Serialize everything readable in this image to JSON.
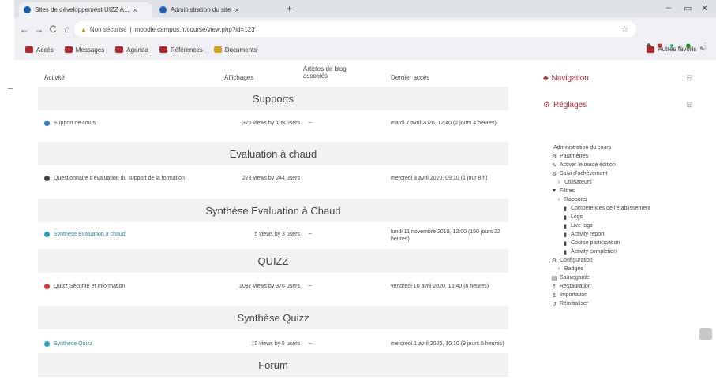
{
  "browser": {
    "tabs": [
      {
        "title": "Sites de développement UIZZ A...",
        "active": true
      },
      {
        "title": "Administration du site",
        "active": false
      }
    ],
    "new_tab": "+",
    "window_controls": {
      "minimize": "–",
      "restore": "▭",
      "close": "✕"
    },
    "nav": {
      "back": "←",
      "forward": "→",
      "reload": "C",
      "home": "⌂"
    },
    "address": {
      "security_label": "Non sécurisé",
      "url": "moodle.campus.fr/course/view.php?id=123"
    },
    "bookmarks": [
      {
        "label": "Accès",
        "color": "#b3262e"
      },
      {
        "label": "Messages",
        "color": "#b3262e"
      },
      {
        "label": "Agenda",
        "color": "#b3262e"
      },
      {
        "label": "Références",
        "color": "#b3262e"
      },
      {
        "label": "Documents",
        "color": "#d8a11c"
      }
    ],
    "bookmarks_right": "Autres favoris"
  },
  "table": {
    "headers": {
      "activity": "Activité",
      "views": "Affichages",
      "blog": "Articles de blog associés",
      "last_access": "Dernier accès"
    },
    "sections": [
      {
        "title": "Supports",
        "rows": [
          {
            "icon_color": "#2a7fbf",
            "activity": "Support de cours",
            "link": false,
            "views": "375 views by 109 users",
            "blog": "–",
            "last_access": "mardi 7 avril 2020, 12:40 (2 jours 4 heures)"
          }
        ]
      },
      {
        "title": "Evaluation à chaud",
        "rows": [
          {
            "icon_color": "#444444",
            "activity": "Questionnaire d'évaluation du support de la formation",
            "link": false,
            "views": "273 views by 244 users",
            "blog": "",
            "last_access": "mercredi 8 avril 2020, 09:10 (1 jour 8 h)"
          }
        ]
      },
      {
        "title": "Synthèse Evaluation à Chaud",
        "rows": [
          {
            "icon_color": "#2aa3b8",
            "activity": "Synthèse Evaluation à chaud",
            "link": true,
            "views": "5 views by 3 users",
            "blog": "–",
            "last_access": "lundi 11 novembre 2019, 12:00 (150 jours 22 heures)"
          }
        ]
      },
      {
        "title": "QUIZZ",
        "rows": [
          {
            "icon_color": "#d33a3a",
            "activity": "Quizz Sécurité et Information",
            "link": false,
            "views": "2087 views by 376 users",
            "blog": "–",
            "last_access": "vendredi 10 avril 2020, 15:40 (6 heures)"
          }
        ]
      },
      {
        "title": "Synthèse Quizz",
        "rows": [
          {
            "icon_color": "#2aa3b8",
            "activity": "Synthèse Quizz",
            "link": true,
            "views": "10 views by 5 users",
            "blog": "–",
            "last_access": "mercredi 1 avril 2020, 10:10 (9 jours 5 heures)"
          }
        ]
      },
      {
        "title": "Forum",
        "rows": []
      }
    ]
  },
  "sidebar": {
    "navigation_title": "Navigation",
    "settings_title": "Réglages",
    "collapse_symbol": "⊟",
    "tree": [
      {
        "level": 1,
        "icon": "",
        "label": "Administration du cours"
      },
      {
        "level": 2,
        "icon": "⚙",
        "label": "Paramètres"
      },
      {
        "level": 2,
        "icon": "✎",
        "label": "Activer le mode édition"
      },
      {
        "level": 2,
        "icon": "⚙",
        "label": "Suivi d'achèvement"
      },
      {
        "level": 3,
        "icon": "›",
        "label": "Utilisateurs"
      },
      {
        "level": 2,
        "icon": "▼",
        "label": "Filtres"
      },
      {
        "level": 3,
        "icon": "›",
        "label": "Rapports"
      },
      {
        "level": 4,
        "icon": "▮",
        "label": "Compétences de l'établissement"
      },
      {
        "level": 4,
        "icon": "▮",
        "label": "Logs"
      },
      {
        "level": 4,
        "icon": "▮",
        "label": "Live logs"
      },
      {
        "level": 4,
        "icon": "▮",
        "label": "Activity report"
      },
      {
        "level": 4,
        "icon": "▮",
        "label": "Course participation"
      },
      {
        "level": 4,
        "icon": "▮",
        "label": "Activity completion"
      },
      {
        "level": 2,
        "icon": "⚙",
        "label": "Configuration"
      },
      {
        "level": 3,
        "icon": "›",
        "label": "Badges"
      },
      {
        "level": 2,
        "icon": "▤",
        "label": "Sauvegarde"
      },
      {
        "level": 2,
        "icon": "↥",
        "label": "Restauration"
      },
      {
        "level": 2,
        "icon": "↥",
        "label": "Importation"
      },
      {
        "level": 2,
        "icon": "↺",
        "label": "Réinitialiser"
      }
    ]
  }
}
